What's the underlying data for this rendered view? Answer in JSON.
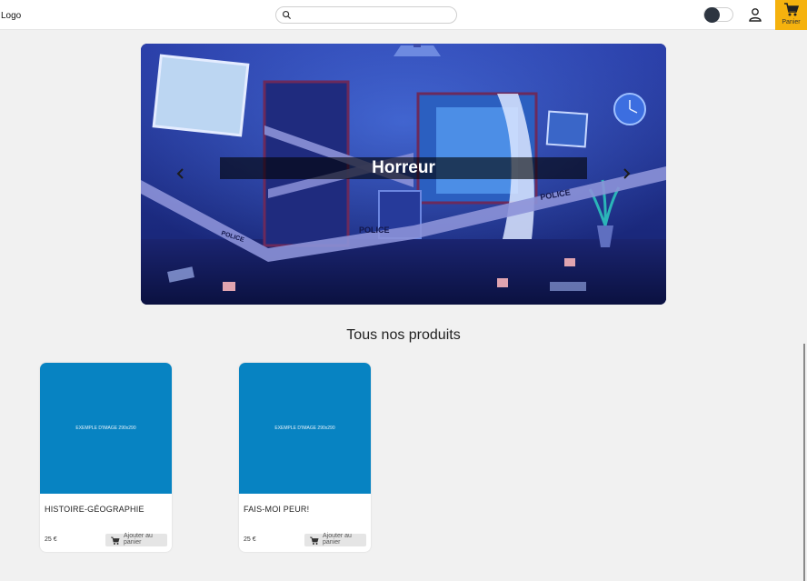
{
  "header": {
    "logo_text": "Logo",
    "search": {
      "value": "",
      "placeholder": ""
    },
    "theme_toggle": {
      "state": "off"
    },
    "cart_label": "Panier"
  },
  "hero": {
    "caption": "Horreur",
    "scene_text": {
      "tape_label": "POLICE"
    }
  },
  "products": {
    "section_title": "Tous nos produits",
    "items": [
      {
        "image_text": "EXEMPLE D'IMAGE 290x290",
        "name": "HISTOIRE-GÉOGRAPHIE",
        "price": "25 €",
        "add_label": "Ajouter au panier"
      },
      {
        "image_text": "EXEMPLE D'IMAGE 290x290",
        "name": "FAIS-MOI PEUR!",
        "price": "25 €",
        "add_label": "Ajouter au panier"
      }
    ]
  },
  "colors": {
    "header_bg": "#ffffff",
    "page_bg": "#f1f1f1",
    "cart_accent": "#f5b20e",
    "product_image_bg": "#0783c2",
    "hero_night_blue": "#1b2a86"
  },
  "icons": {
    "search": "search-icon",
    "user": "user-icon",
    "cart": "cart-icon",
    "prev": "chevron-left-icon",
    "next": "chevron-right-icon"
  }
}
